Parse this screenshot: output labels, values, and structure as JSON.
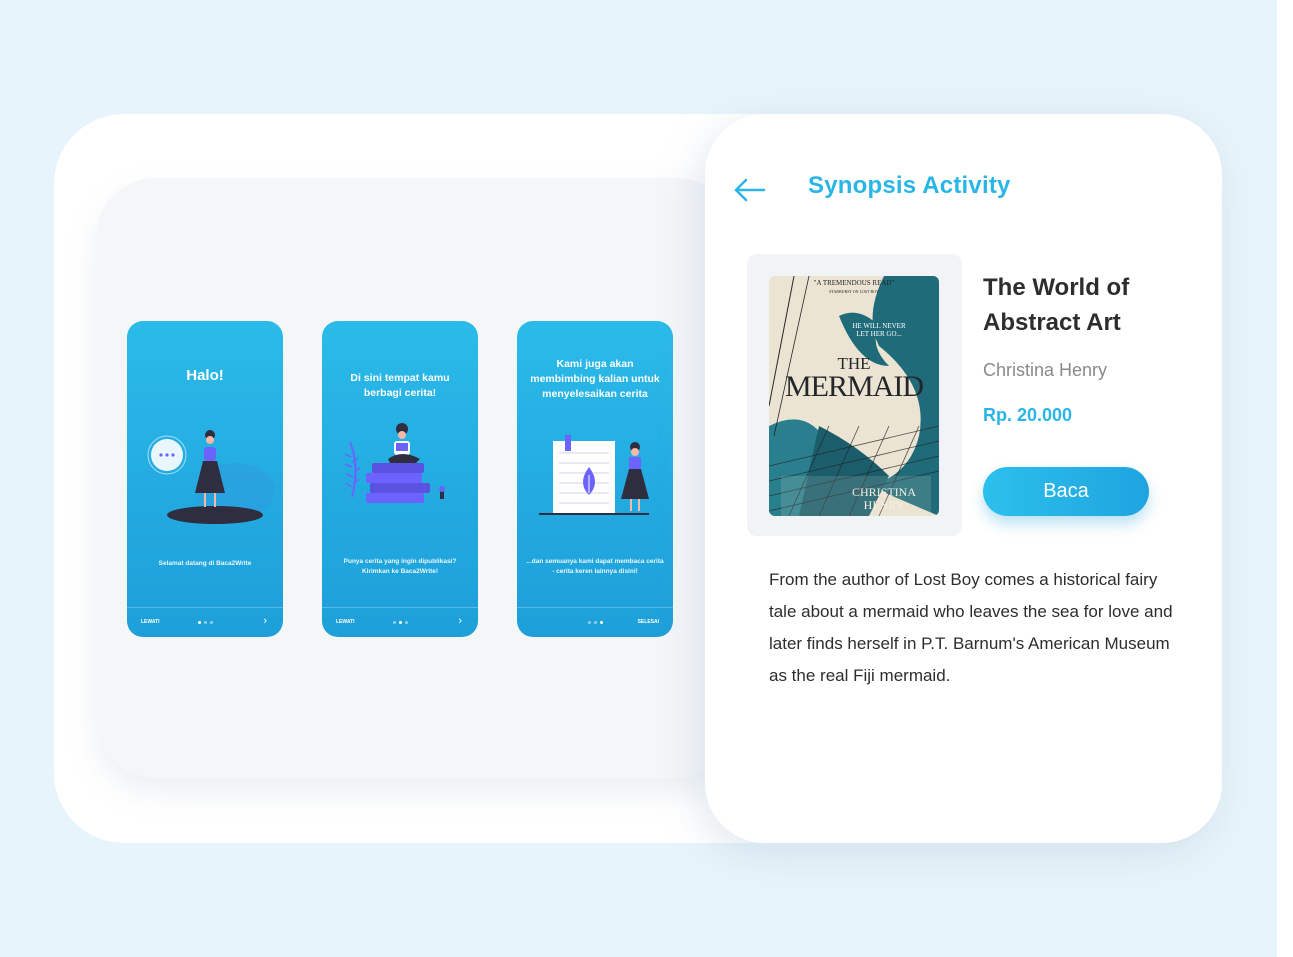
{
  "screens": [
    {
      "title": "Halo!",
      "caption": "Selamat datang di Baca2Write",
      "footer_left": "LEWATI",
      "footer_right": "",
      "active_dot": 0
    },
    {
      "title": "Di sini tempat kamu berbagi cerita!",
      "caption": "Punya cerita yang ingin dipublikasi? Kirimkan ke Baca2Write!",
      "footer_left": "LEWATI",
      "footer_right": "",
      "active_dot": 1
    },
    {
      "title": "Kami juga akan membimbing kalian untuk menyelesaikan cerita",
      "caption": "...dan semuanya kami dapat membaca cerita - cerita keren lainnya disini!",
      "footer_left": "",
      "footer_right": "SELESAI",
      "active_dot": 2
    }
  ],
  "synopsis_activity": {
    "back_icon": "arrow-left-icon",
    "title": "Synopsis Activity",
    "cover": {
      "quote": "\"A TREMENDOUS READ\"",
      "quote_source": "STARBURST ON LOST BOY",
      "tagline": "HE WILL NEVER LET HER GO...",
      "title_small": "THE",
      "title_big": "MERMAID",
      "author_line1": "CHRISTINA",
      "author_line2": "HENRY"
    },
    "book_title": "The World of Abstract Art",
    "author": "Christina Henry",
    "price": "Rp. 20.000",
    "read_button": "Baca",
    "synopsis": "From the author of Lost Boy comes a historical fairy tale about a mermaid who leaves the sea for love and later finds herself in P.T. Barnum's American Museum as the real Fiji mermaid."
  },
  "colors": {
    "accent": "#29b6e6",
    "background": "#e8f4fb",
    "phone_top": "#2bbbe9",
    "phone_bottom": "#1e9fd9",
    "illustration_purple": "#6c63ff",
    "dark": "#2f2e41"
  }
}
